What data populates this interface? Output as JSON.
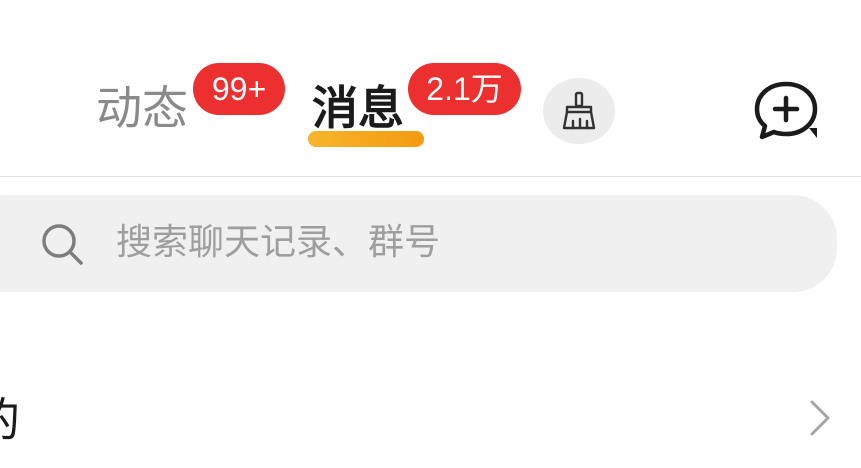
{
  "header": {
    "tabs": [
      {
        "label": "动态",
        "badge": "99+",
        "active": false
      },
      {
        "label": "消息",
        "badge": "2.1万",
        "active": true
      }
    ],
    "clean_button_icon": "broom-icon",
    "add_chat_icon": "add-chat-bubble-icon"
  },
  "search": {
    "placeholder": "搜索聊天记录、群号",
    "icon": "search-icon"
  },
  "list": {
    "items": [
      {
        "label": "的"
      }
    ],
    "chevron_icon": "chevron-right-icon"
  },
  "colors": {
    "badge": "#ec2f2f",
    "active_underline": "#f5a81e",
    "search_bg": "#f0f0f0"
  }
}
